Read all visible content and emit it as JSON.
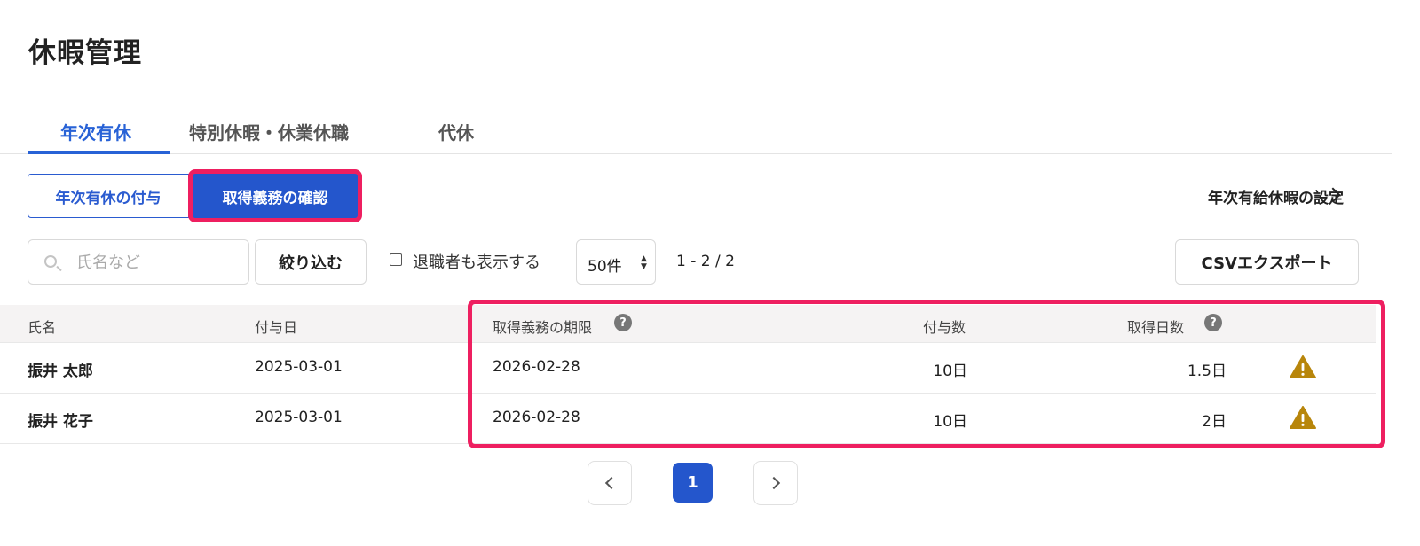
{
  "page_title": "休暇管理",
  "tabs": [
    {
      "label": "年次有休",
      "active": true
    },
    {
      "label": "特別休暇・休業休職",
      "active": false
    },
    {
      "label": "代休",
      "active": false
    }
  ],
  "subtabs": {
    "grant_label": "年次有休の付与",
    "obligation_label": "取得義務の確認"
  },
  "settings_link": "年次有給休暇の設定",
  "search": {
    "placeholder": "氏名など",
    "value": ""
  },
  "filter_label": "絞り込む",
  "show_retired_label": "退職者も表示する",
  "per_page": "50件",
  "range_text": "1 - 2 / 2",
  "csv_label": "CSVエクスポート",
  "table": {
    "headers": {
      "name": "氏名",
      "grant_date": "付与日",
      "deadline": "取得義務の期限",
      "granted": "付与数",
      "taken": "取得日数"
    },
    "rows": [
      {
        "name": "振井 太郎",
        "grant_date": "2025-03-01",
        "deadline": "2026-02-28",
        "granted": "10日",
        "taken": "1.5日",
        "warning": true
      },
      {
        "name": "振井 花子",
        "grant_date": "2025-03-01",
        "deadline": "2026-02-28",
        "granted": "10日",
        "taken": "2日",
        "warning": true
      }
    ]
  },
  "pagination": {
    "current": "1"
  },
  "colors": {
    "accent": "#2456cc",
    "highlight": "#ee1f60",
    "warning": "#b8860b"
  },
  "icons": [
    "search-icon",
    "help-icon",
    "warning-icon",
    "chevron-left-icon",
    "chevron-right-icon"
  ]
}
